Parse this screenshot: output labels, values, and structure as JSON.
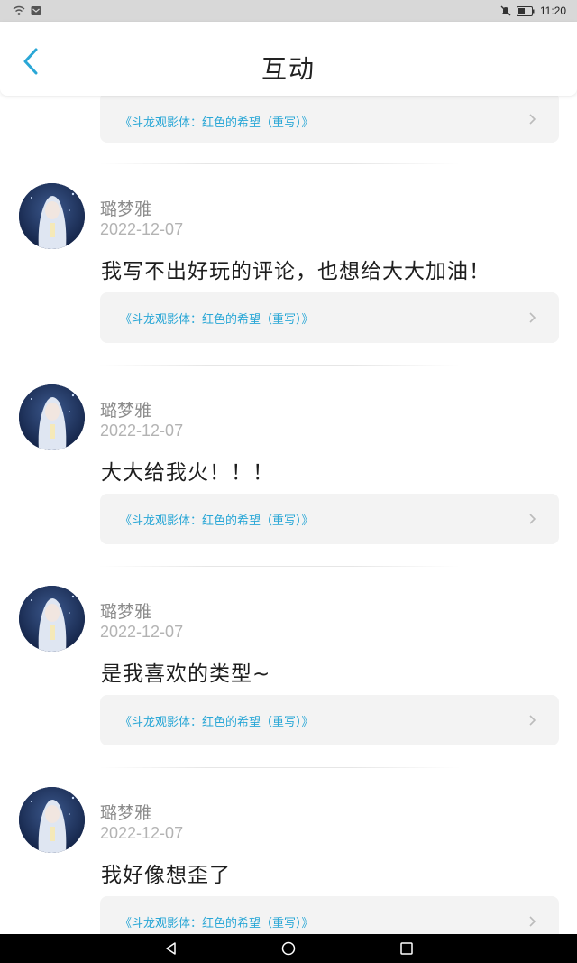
{
  "status_bar": {
    "time": "11:20",
    "icons": [
      "wifi-icon",
      "notification-icon",
      "mute-icon",
      "battery-icon"
    ]
  },
  "header": {
    "title": "互动",
    "back_icon": "chevron-left-icon",
    "accent_color": "#2aa7d6"
  },
  "top_card": {
    "link_text": "《斗龙观影体：红色的希望（重写）》"
  },
  "comments": [
    {
      "username": "璐梦雅",
      "date": "2022-12-07",
      "text": "我写不出好玩的评论，也想给大大加油！",
      "link_text": "《斗龙观影体：红色的希望（重写）》"
    },
    {
      "username": "璐梦雅",
      "date": "2022-12-07",
      "text": "大大给我火！！！",
      "link_text": "《斗龙观影体：红色的希望（重写）》"
    },
    {
      "username": "璐梦雅",
      "date": "2022-12-07",
      "text": "是我喜欢的类型~",
      "link_text": "《斗龙观影体：红色的希望（重写）》"
    },
    {
      "username": "璐梦雅",
      "date": "2022-12-07",
      "text": "我好像想歪了",
      "link_text": "《斗龙观影体：红色的希望（重写）》"
    }
  ],
  "nav_bar": {
    "icons": [
      "back-triangle-icon",
      "home-circle-icon",
      "recents-square-icon"
    ]
  }
}
